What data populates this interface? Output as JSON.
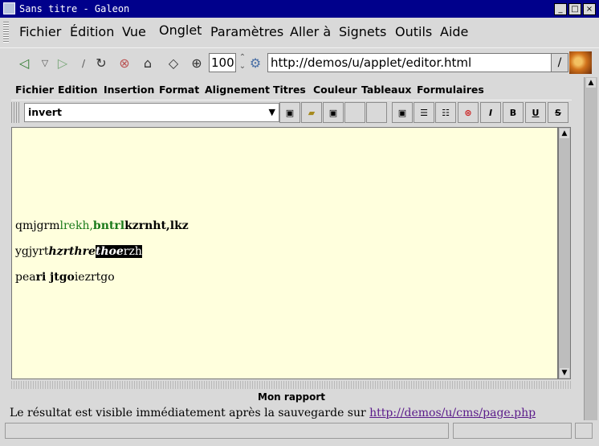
{
  "window": {
    "title": "Sans titre - Galeon",
    "buttons": [
      "_",
      "□",
      "×"
    ]
  },
  "menubar": {
    "items": [
      "Fichier",
      "Édition",
      "Vue",
      "Onglet",
      "Paramètres",
      "Aller à",
      "Signets",
      "Outils",
      "Aide"
    ]
  },
  "toolbar": {
    "back_icon": "back-arrow-icon",
    "forward_icon": "forward-arrow-icon",
    "reload_icon": "reload-icon",
    "stop_icon": "stop-icon",
    "home_icon": "home-icon",
    "zoom_value": "100",
    "url": "http://demos/u/applet/editor.html",
    "go_label": "/"
  },
  "applet": {
    "menu": [
      "Fichier",
      "Edition",
      "Insertion",
      "Format",
      "Alignement",
      "Titres",
      "Couleur",
      "Tableaux",
      "Formulaires"
    ],
    "style_select": "invert",
    "format_buttons": {
      "italic": "I",
      "bold": "B",
      "underline": "U",
      "strike": "S"
    }
  },
  "editor": {
    "line1": {
      "a": "qmjgrm",
      "b": "lrekh,",
      "c": "bntrl",
      "d": "kzrnht,lkz"
    },
    "line2": {
      "a": "ygjyrt",
      "b": "hzrthre",
      "c": "thoe",
      "d": "rzh"
    },
    "line3": {
      "a": "pea",
      "b": "ri jtgo",
      "c": "iezrtgo"
    }
  },
  "report": {
    "label": "Mon rapport",
    "result_text": "Le résultat est visible immédiatement après la sauvegarde sur",
    "result_link": "http://demos/u/cms/page.php"
  },
  "colors": {
    "titlebar": "#00008b",
    "editor_bg": "#ffffdd",
    "green_text": "#1a7a1a",
    "link": "#5a1a8a"
  }
}
